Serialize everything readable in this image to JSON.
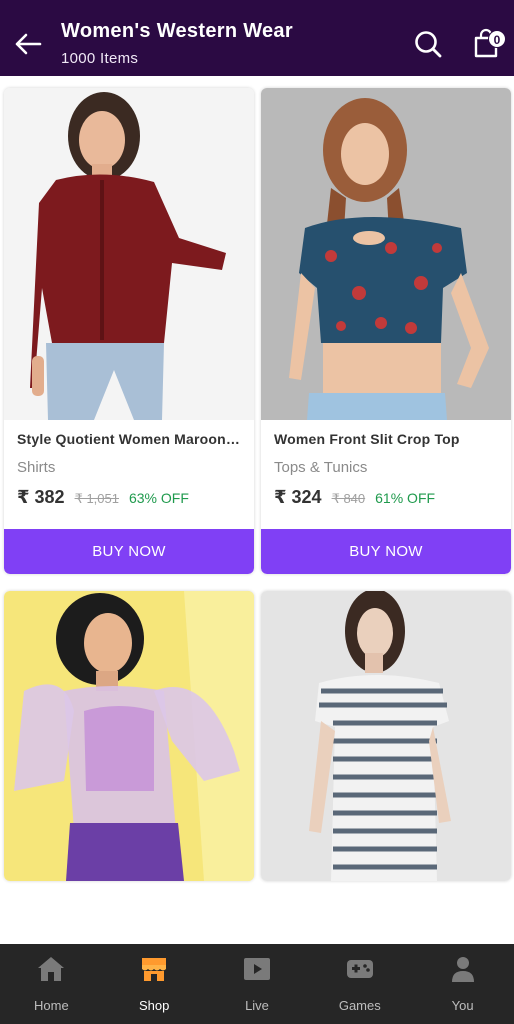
{
  "header": {
    "title": "Women's Western Wear",
    "subtitle": "1000 Items",
    "cart_count": "0"
  },
  "products": [
    {
      "name": "Style Quotient Women Maroon…",
      "category": "Shirts",
      "price": "₹ 382",
      "mrp": "₹ 1,051",
      "discount": "63% OFF",
      "buy_label": "BUY NOW"
    },
    {
      "name": "Women Front Slit Crop Top",
      "category": "Tops & Tunics",
      "price": "₹ 324",
      "mrp": "₹ 840",
      "discount": "61% OFF",
      "buy_label": "BUY NOW"
    }
  ],
  "bottom_nav": [
    {
      "label": "Home",
      "icon": "home-icon"
    },
    {
      "label": "Shop",
      "icon": "shop-icon",
      "active": true
    },
    {
      "label": "Live",
      "icon": "live-icon"
    },
    {
      "label": "Games",
      "icon": "gamepad-icon"
    },
    {
      "label": "You",
      "icon": "user-icon"
    }
  ],
  "colors": {
    "header_bg": "#2b0a43",
    "accent": "#8040f5",
    "discount": "#1f9a4d",
    "nav_bg": "#262626",
    "active_icon": "#ff9a2e"
  }
}
